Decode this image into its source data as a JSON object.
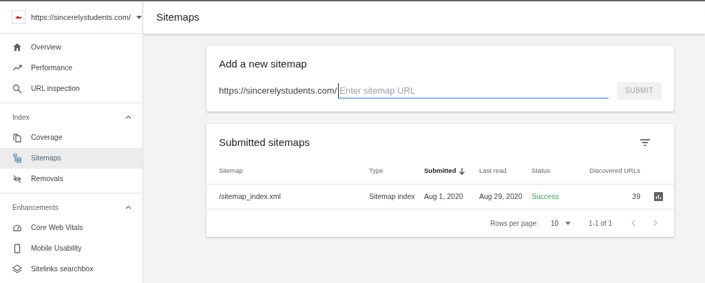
{
  "property_selector": {
    "url": "https://sincerelystudents.com/"
  },
  "page_title": "Sitemaps",
  "sidebar": {
    "sections": [
      {
        "items": [
          {
            "label": "Overview",
            "selected": false
          },
          {
            "label": "Performance",
            "selected": false
          },
          {
            "label": "URL inspection",
            "selected": false
          }
        ]
      },
      {
        "heading": "Index",
        "expanded": true,
        "items": [
          {
            "label": "Coverage",
            "selected": false
          },
          {
            "label": "Sitemaps",
            "selected": true
          },
          {
            "label": "Removals",
            "selected": false
          }
        ]
      },
      {
        "heading": "Enhancements",
        "expanded": true,
        "items": [
          {
            "label": "Core Web Vitals",
            "selected": false
          },
          {
            "label": "Mobile Usability",
            "selected": false
          },
          {
            "label": "Sitelinks searchbox",
            "selected": false
          }
        ]
      }
    ]
  },
  "add_sitemap": {
    "title": "Add a new sitemap",
    "prefix": "https://sincerelystudents.com/",
    "placeholder": "Enter sitemap URL",
    "submit": {
      "label": "SUBMIT",
      "disabled": true
    }
  },
  "submitted_sitemaps": {
    "title": "Submitted sitemaps",
    "columns": [
      {
        "label": "Sitemap",
        "sorted": false
      },
      {
        "label": "Type",
        "sorted": false
      },
      {
        "label": "Submitted",
        "sorted": true
      },
      {
        "label": "Last read",
        "sorted": false
      },
      {
        "label": "Status",
        "sorted": false
      },
      {
        "label": "Discovered URLs",
        "sorted": false
      }
    ],
    "rows": [
      {
        "sitemap": "/sitemap_index.xml",
        "type": "Sitemap index",
        "submitted": "Aug 1, 2020",
        "last_read": "Aug 29, 2020",
        "status": "Success",
        "discovered_urls": "39"
      }
    ],
    "pagination": {
      "rows_per_page_label": "Rows per page:",
      "rows_per_page": "10",
      "range": "1-1 of 1"
    }
  }
}
